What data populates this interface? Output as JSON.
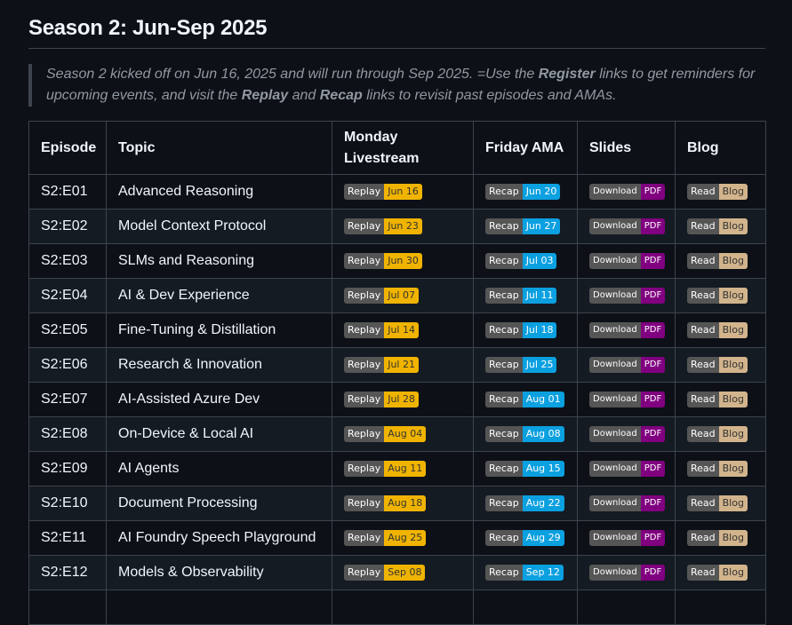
{
  "title": "Season 2: Jun-Sep 2025",
  "intro": {
    "t1": "Season 2 kicked off on Jun 16, 2025 and will run through Sep 2025. =Use the ",
    "b1": "Register",
    "t2": " links to get reminders for upcoming events, and visit the ",
    "b2": "Replay",
    "t3": " and ",
    "b3": "Recap",
    "t4": " links to revisit past episodes and AMAs."
  },
  "headers": [
    "Episode",
    "Topic",
    "Monday Livestream",
    "Friday AMA",
    "Slides",
    "Blog"
  ],
  "colors": {
    "replay": "#f0b400",
    "recap": "#0ba0e0",
    "pdf": "#800080",
    "blog": "#d2b48c"
  },
  "labels": {
    "replay": "Replay",
    "recap": "Recap",
    "download": "Download",
    "pdf": "PDF",
    "read": "Read",
    "blog": "Blog"
  },
  "rows": [
    {
      "episode": "S2:E01",
      "topic": "Advanced Reasoning",
      "replay": "Jun 16",
      "recap": "Jun 20"
    },
    {
      "episode": "S2:E02",
      "topic": "Model Context Protocol",
      "replay": "Jun 23",
      "recap": "Jun 27"
    },
    {
      "episode": "S2:E03",
      "topic": "SLMs and Reasoning",
      "replay": "Jun 30",
      "recap": "Jul 03"
    },
    {
      "episode": "S2:E04",
      "topic": "AI & Dev Experience",
      "replay": "Jul 07",
      "recap": "Jul 11"
    },
    {
      "episode": "S2:E05",
      "topic": "Fine-Tuning & Distillation",
      "replay": "Jul 14",
      "recap": "Jul 18"
    },
    {
      "episode": "S2:E06",
      "topic": "Research & Innovation",
      "replay": "Jul 21",
      "recap": "Jul 25"
    },
    {
      "episode": "S2:E07",
      "topic": "AI-Assisted Azure Dev",
      "replay": "Jul 28",
      "recap": "Aug 01"
    },
    {
      "episode": "S2:E08",
      "topic": "On-Device & Local AI",
      "replay": "Aug 04",
      "recap": "Aug 08"
    },
    {
      "episode": "S2:E09",
      "topic": "AI Agents",
      "replay": "Aug 11",
      "recap": "Aug 15"
    },
    {
      "episode": "S2:E10",
      "topic": "Document Processing",
      "replay": "Aug 18",
      "recap": "Aug 22"
    },
    {
      "episode": "S2:E11",
      "topic": "AI Foundry Speech Playground",
      "replay": "Aug 25",
      "recap": "Aug 29"
    },
    {
      "episode": "S2:E12",
      "topic": "Models & Observability",
      "replay": "Sep 08",
      "recap": "Sep 12"
    }
  ]
}
